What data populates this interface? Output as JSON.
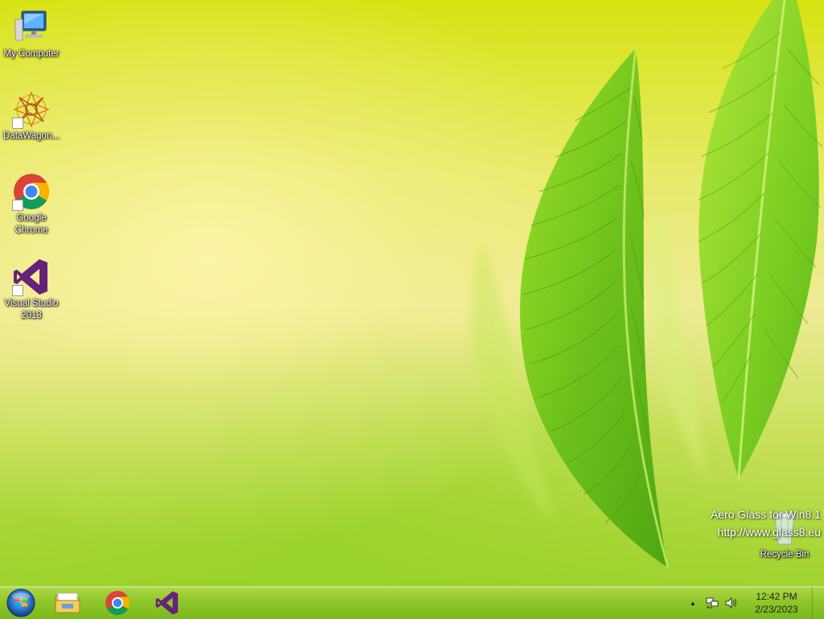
{
  "desktop": {
    "icons": [
      {
        "label": "My Computer"
      },
      {
        "label": "DataWagon..."
      },
      {
        "label": "Google Chrome"
      },
      {
        "label": "Visual Studio 2013"
      }
    ],
    "recycle_bin": {
      "label": "Recycle Bin"
    },
    "watermark": {
      "line1": "Aero Glass for Win8.1",
      "line2": "http://www.glass8.eu"
    }
  },
  "taskbar": {
    "pinned": [
      {
        "icon": "start-orb-icon"
      },
      {
        "icon": "file-explorer-icon"
      },
      {
        "icon": "chrome-icon"
      },
      {
        "icon": "visual-studio-icon"
      }
    ],
    "tray": {
      "chevron": "▲",
      "icons": [
        "network-icon",
        "volume-icon"
      ]
    },
    "clock": {
      "time": "12:42 PM",
      "date": "2/23/2023"
    }
  },
  "colors": {
    "taskbar": "#8fc72a",
    "wallpaper_top": "#d7e312",
    "leaf_green": "#7cc61f"
  }
}
